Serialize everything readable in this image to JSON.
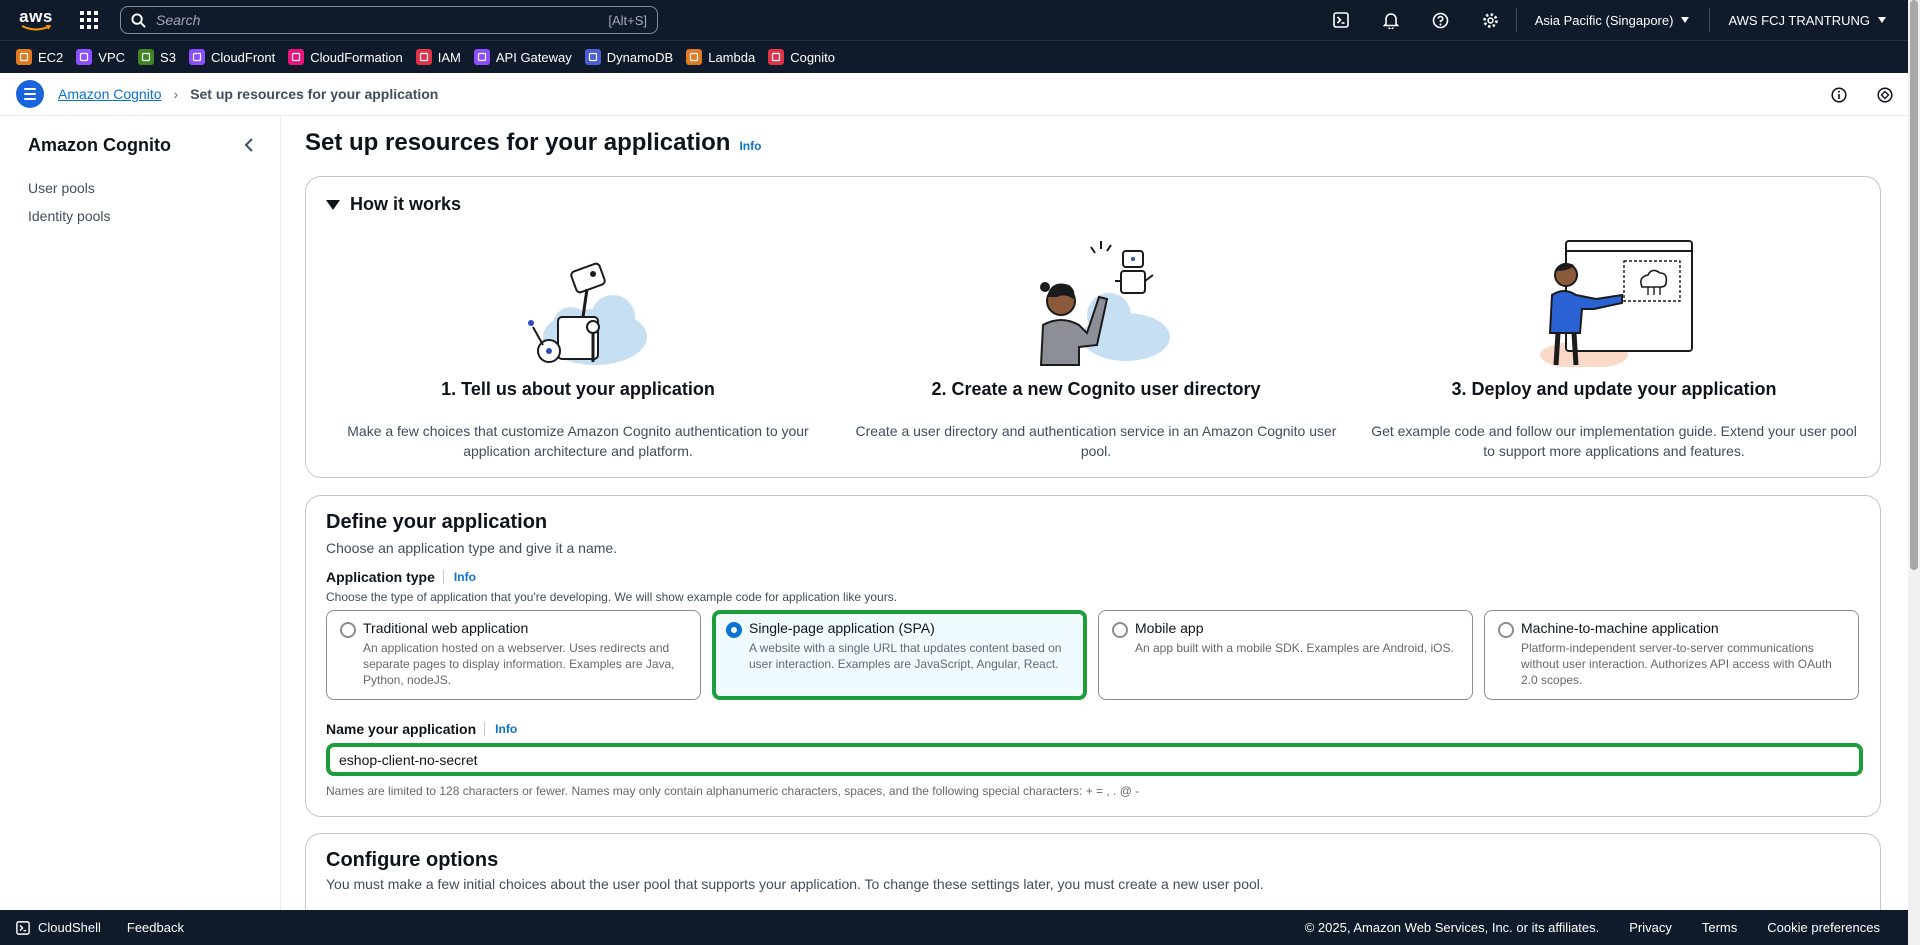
{
  "topnav": {
    "logo": "aws",
    "search_placeholder": "Search",
    "search_shortcut": "[Alt+S]",
    "region": "Asia Pacific (Singapore)",
    "account": "AWS FCJ TRANTRUNG",
    "icons": [
      "cloudshell-icon",
      "bell-icon",
      "help-icon",
      "settings-icon"
    ]
  },
  "favorites": [
    {
      "label": "EC2",
      "color": "#e07b24"
    },
    {
      "label": "VPC",
      "color": "#8c4fff"
    },
    {
      "label": "S3",
      "color": "#3f8624"
    },
    {
      "label": "CloudFront",
      "color": "#8c4fff"
    },
    {
      "label": "CloudFormation",
      "color": "#e7157b"
    },
    {
      "label": "IAM",
      "color": "#dd344c"
    },
    {
      "label": "API Gateway",
      "color": "#8c4fff"
    },
    {
      "label": "DynamoDB",
      "color": "#4d5fd4"
    },
    {
      "label": "Lambda",
      "color": "#e07b24"
    },
    {
      "label": "Cognito",
      "color": "#dd344c"
    }
  ],
  "breadcrumb": {
    "parent": "Amazon Cognito",
    "current": "Set up resources for your application"
  },
  "sidebar": {
    "title": "Amazon Cognito",
    "items": [
      "User pools",
      "Identity pools"
    ]
  },
  "page": {
    "title": "Set up resources for your application",
    "info": "Info"
  },
  "how_it_works": {
    "heading": "How it works",
    "steps": [
      {
        "title": "1. Tell us about your application",
        "desc": "Make a few choices that customize Amazon Cognito authentication to your application architecture and platform."
      },
      {
        "title": "2. Create a new Cognito user directory",
        "desc": "Create a user directory and authentication service in an Amazon Cognito user pool."
      },
      {
        "title": "3. Deploy and update your application",
        "desc": "Get example code and follow our implementation guide. Extend your user pool to support more applications and features."
      }
    ]
  },
  "define": {
    "title": "Define your application",
    "desc": "Choose an application type and give it a name.",
    "app_type_label": "Application type",
    "app_type_info": "Info",
    "app_type_desc": "Choose the type of application that you're developing. We will show example code for application like yours.",
    "types": [
      {
        "title": "Traditional web application",
        "desc": "An application hosted on a webserver. Uses redirects and separate pages to display information. Examples are Java, Python, nodeJS.",
        "selected": false
      },
      {
        "title": "Single-page application (SPA)",
        "desc": "A website with a single URL that updates content based on user interaction. Examples are JavaScript, Angular, React.",
        "selected": true
      },
      {
        "title": "Mobile app",
        "desc": "An app built with a mobile SDK. Examples are Android, iOS.",
        "selected": false
      },
      {
        "title": "Machine-to-machine application",
        "desc": "Platform-independent server-to-server communications without user interaction. Authorizes API access with OAuth 2.0 scopes.",
        "selected": false
      }
    ],
    "name_label": "Name your application",
    "name_info": "Info",
    "name_value": "eshop-client-no-secret",
    "name_constraint": "Names are limited to 128 characters or fewer. Names may only contain alphanumeric characters, spaces, and the following special characters: + = , . @ -"
  },
  "configure": {
    "title": "Configure options",
    "desc": "You must make a few initial choices about the user pool that supports your application. To change these settings later, you must create a new user pool."
  },
  "footer": {
    "cloudshell": "CloudShell",
    "feedback": "Feedback",
    "copyright": "© 2025, Amazon Web Services, Inc. or its affiliates.",
    "privacy": "Privacy",
    "terms": "Terms",
    "cookies": "Cookie preferences"
  },
  "colors": {
    "nav_bg": "#0f1b2a",
    "link": "#0972d3",
    "highlight": "#1e9e3a"
  }
}
